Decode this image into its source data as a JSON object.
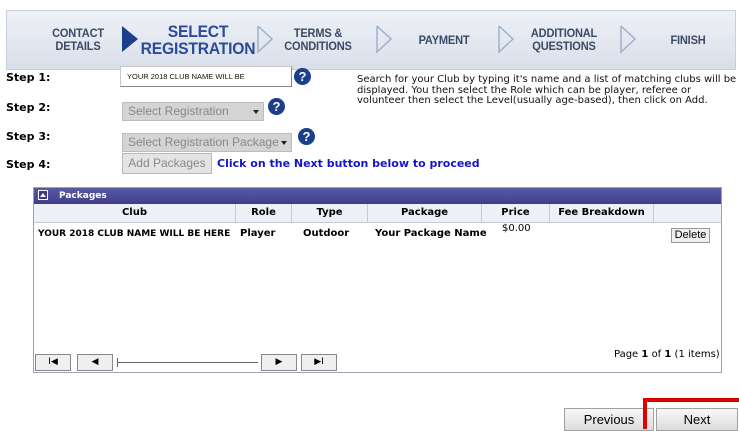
{
  "wizard": {
    "steps": [
      {
        "l1": "CONTACT",
        "l2": "DETAILS"
      },
      {
        "l1": "SELECT",
        "l2": "REGISTRATION"
      },
      {
        "l1": "TERMS &",
        "l2": "CONDITIONS"
      },
      {
        "l1": "PAYMENT",
        "l2": ""
      },
      {
        "l1": "ADDITIONAL",
        "l2": "QUESTIONS"
      },
      {
        "l1": "FINISH",
        "l2": ""
      }
    ]
  },
  "form": {
    "step1_label": "Step 1:",
    "step2_label": "Step 2:",
    "step3_label": "Step 3:",
    "step4_label": "Step 4:",
    "club_value": "YOUR 2018 CLUB NAME WILL BE",
    "registration_select": "Select Registration",
    "package_select": "Select Registration Package",
    "add_button": "Add Packages",
    "proceed_text": "Click on the Next button below to proceed",
    "help_glyph": "?",
    "description": "Search for your Club by typing it's name and a list of matching clubs will be displayed. You then select the Role which can be player, referee or volunteer then select the Level(usually age-based), then click on Add."
  },
  "packages": {
    "title": "Packages",
    "columns": [
      "Club",
      "Role",
      "Type",
      "Package",
      "Price",
      "Fee Breakdown"
    ],
    "rows": [
      {
        "club": "YOUR 2018 CLUB NAME WILL BE HERE",
        "role": "Player",
        "type": "Outdoor",
        "package": "Your Package Name",
        "price": "$0.00",
        "fee": "",
        "action": "Delete"
      }
    ],
    "pager": {
      "first": "I◀",
      "prev": "◀",
      "next": "▶",
      "last": "▶I",
      "page_label": "Page",
      "page": "1",
      "of": "of",
      "total": "1",
      "items": "(1 items)"
    }
  },
  "nav": {
    "previous": "Previous",
    "next": "Next"
  },
  "colors": {
    "accent": "#1b3f8d",
    "header_bar": "#3e3e8a",
    "highlight": "#e00000",
    "link": "#1515c8"
  }
}
